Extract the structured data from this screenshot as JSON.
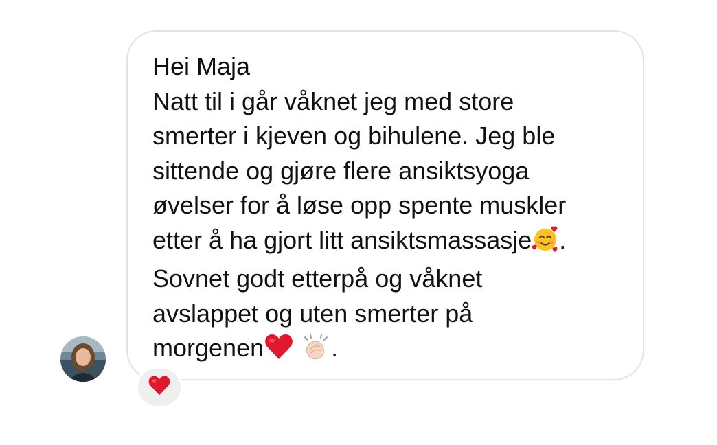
{
  "message": {
    "lines": [
      "Hei Maja",
      "Natt til i går våknet jeg med store",
      "smerter i kjeven og bihulene. Jeg ble",
      "sittende og gjøre flere ansiktsyoga",
      "øvelser for å løse opp spente muskler",
      "etter å ha gjort litt ansiktsmassasje",
      ".",
      "Sovnet godt etterpå og våknet",
      "avslappet og uten smerter på",
      "morgenen",
      "."
    ]
  },
  "icons": {
    "avatar": "avatar",
    "smiling_face_with_hearts": "smiling-face-with-hearts-icon",
    "red_heart": "red-heart-icon",
    "clapping_hands": "clapping-hands-icon",
    "reaction_heart": "heart-reaction-icon"
  },
  "colors": {
    "bubble_border": "#e3e3e3",
    "text": "#111111",
    "reaction_bg": "#efefef",
    "heart": "#e0182d"
  }
}
